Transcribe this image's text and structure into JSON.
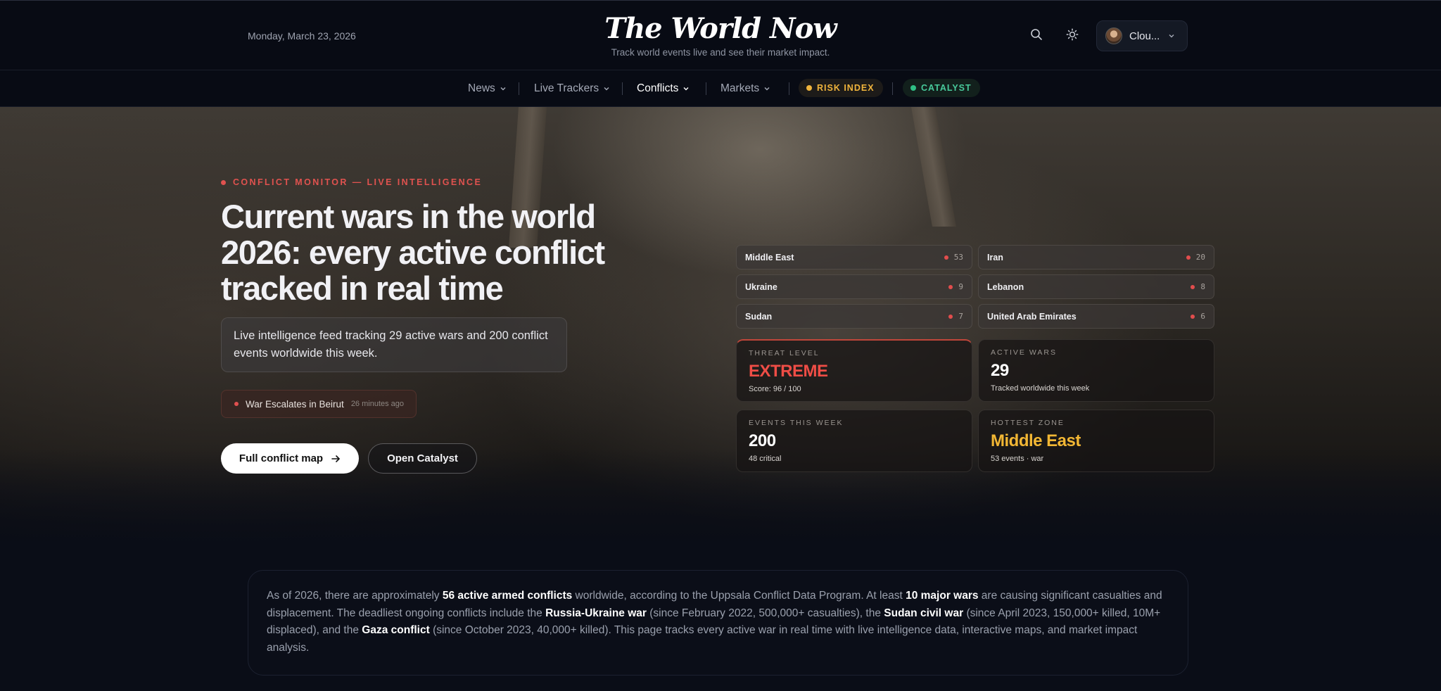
{
  "header": {
    "date": "Monday, March 23, 2026",
    "brand": "The World Now",
    "tagline": "Track world events live and see their market impact.",
    "search_icon": "search-icon",
    "theme_icon": "sun-icon",
    "user_name": "Clou..."
  },
  "nav": {
    "items": [
      {
        "label": "News",
        "active": false
      },
      {
        "label": "Live Trackers",
        "active": false
      },
      {
        "label": "Conflicts",
        "active": true
      },
      {
        "label": "Markets",
        "active": false
      }
    ],
    "risk_index": "RISK INDEX",
    "catalyst": "CATALYST"
  },
  "hero": {
    "eyebrow": "CONFLICT MONITOR — LIVE INTELLIGENCE",
    "headline": "Current wars in the world 2026: every active conflict tracked in real time",
    "intro": "Live intelligence feed tracking 29 active wars and 200 conflict events worldwide this week.",
    "breaking": {
      "title": "War Escalates in Beirut",
      "ago": "26 minutes ago"
    },
    "primary_button": "Full conflict map",
    "secondary_button": "Open Catalyst"
  },
  "regions": [
    {
      "name": "Middle East",
      "count": "53"
    },
    {
      "name": "Iran",
      "count": "20"
    },
    {
      "name": "Ukraine",
      "count": "9"
    },
    {
      "name": "Lebanon",
      "count": "8"
    },
    {
      "name": "Sudan",
      "count": "7"
    },
    {
      "name": "United Arab Emirates",
      "count": "6"
    }
  ],
  "stats": {
    "threat": {
      "label": "THREAT LEVEL",
      "value": "EXTREME",
      "sub": "Score: 96 / 100"
    },
    "wars": {
      "label": "ACTIVE WARS",
      "value": "29",
      "sub": "Tracked worldwide this week"
    },
    "events": {
      "label": "EVENTS THIS WEEK",
      "value": "200",
      "sub": "48 critical"
    },
    "hottest": {
      "label": "HOTTEST ZONE",
      "value": "Middle East",
      "sub": "53 events · war"
    }
  },
  "summary": {
    "p1": "As of 2026, there are approximately ",
    "b1": "56 active armed conflicts",
    "p2": " worldwide, according to the Uppsala Conflict Data Program. At least ",
    "b2": "10 major wars",
    "p3": " are causing significant casualties and displacement. The deadliest ongoing conflicts include the ",
    "b3": "Russia-Ukraine war",
    "p4": " (since February 2022, 500,000+ casualties), the ",
    "b4": "Sudan civil war",
    "p5": " (since April 2023, 150,000+ killed, 10M+ displaced), and the ",
    "b5": "Gaza conflict",
    "p6": " (since October 2023, 40,000+ killed). This page tracks every active war in real time with live intelligence data, interactive maps, and market impact analysis."
  },
  "colors": {
    "accent_red": "#e0524f",
    "risk_amber": "#f0b43c",
    "catalyst_green": "#2fbf85",
    "background": "#0a0d17"
  }
}
